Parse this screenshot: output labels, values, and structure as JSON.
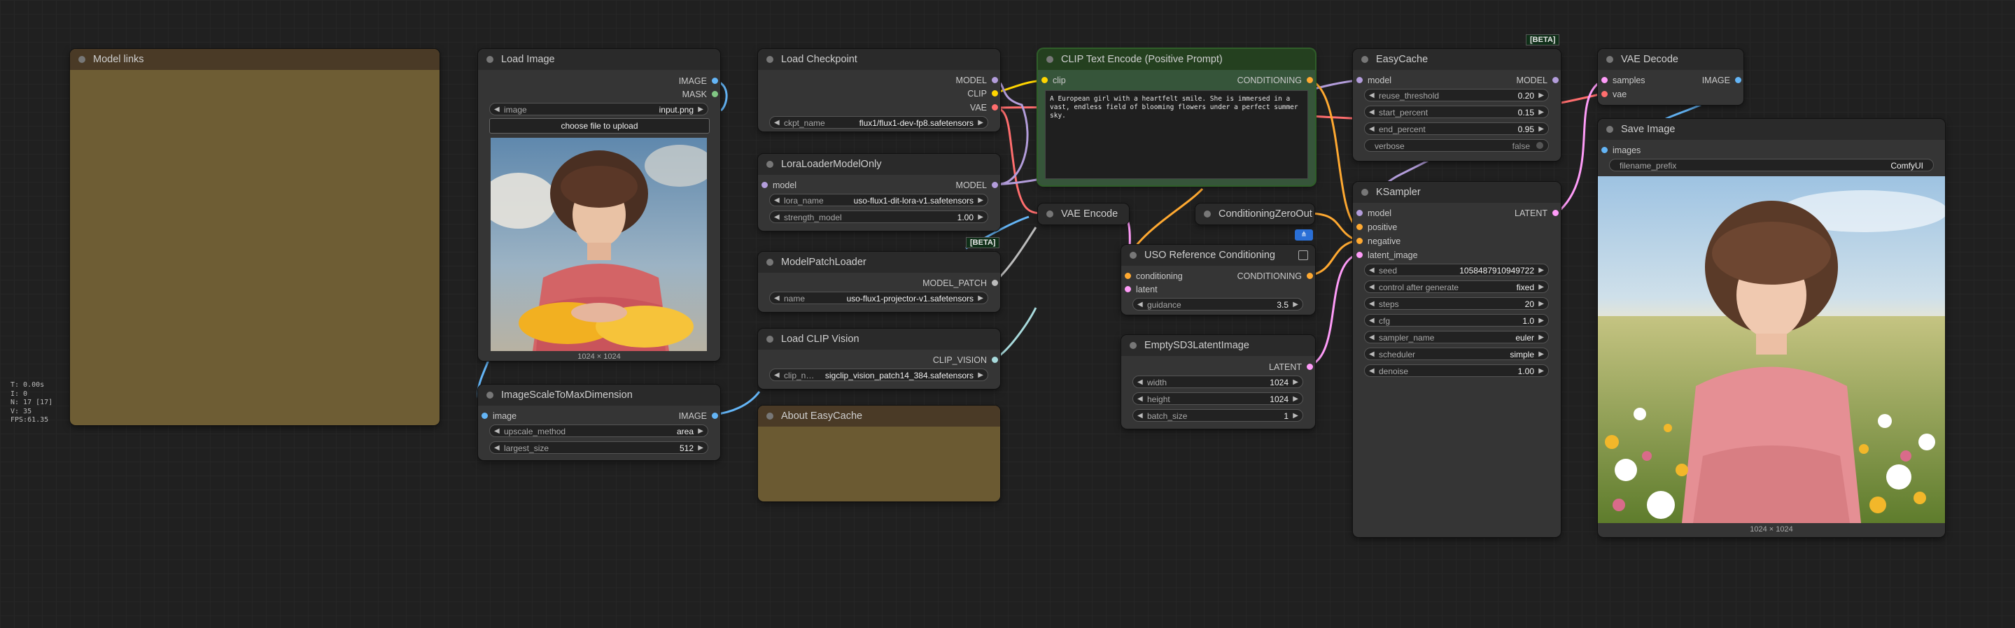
{
  "colors": {
    "model": "#b39ddb",
    "clip": "#ffd500",
    "vae": "#ff6e6e",
    "conditioning": "#ffa931",
    "latent": "#ff9cf9",
    "image": "#64b5f6",
    "mask": "#81c784",
    "model_patch": "#bbbbbb",
    "clip_vision": "#a8dadc"
  },
  "stats": {
    "t": "T: 0.00s",
    "i": "I: 0",
    "n": "N: 17 [17]",
    "v": "V: 35",
    "fps": "FPS:61.35"
  },
  "model_links": {
    "title": "Model links"
  },
  "load_image": {
    "title": "Load Image",
    "out_image": "IMAGE",
    "out_mask": "MASK",
    "image_label": "image",
    "image_value": "input.png",
    "upload_button": "choose file to upload",
    "size": "1024 × 1024"
  },
  "image_scale": {
    "title": "ImageScaleToMaxDimension",
    "in_image": "image",
    "out_image": "IMAGE",
    "upscale_label": "upscale_method",
    "upscale_value": "area",
    "largest_label": "largest_size",
    "largest_value": "512"
  },
  "load_checkpoint": {
    "title": "Load Checkpoint",
    "out_model": "MODEL",
    "out_clip": "CLIP",
    "out_vae": "VAE",
    "ckpt_label": "ckpt_name",
    "ckpt_value": "flux1/flux1-dev-fp8.safetensors"
  },
  "lora_loader": {
    "title": "LoraLoaderModelOnly",
    "in_model": "model",
    "out_model": "MODEL",
    "lora_label": "lora_name",
    "lora_value": "uso-flux1-dit-lora-v1.safetensors",
    "strength_label": "strength_model",
    "strength_value": "1.00"
  },
  "model_patch_loader": {
    "title": "ModelPatchLoader",
    "badge": "[BETA]",
    "out_patch": "MODEL_PATCH",
    "name_label": "name",
    "name_value": "uso-flux1-projector-v1.safetensors"
  },
  "load_clip_vision": {
    "title": "Load CLIP Vision",
    "out_clip_vision": "CLIP_VISION",
    "clip_label": "clip_n…",
    "clip_value": "sigclip_vision_patch14_384.safetensors"
  },
  "about_easycache": {
    "title": "About EasyCache"
  },
  "clip_text_encode": {
    "title": "CLIP Text Encode (Positive Prompt)",
    "in_clip": "clip",
    "out_cond": "CONDITIONING",
    "prompt": "A European girl with a heartfelt smile. She is immersed in a vast, endless field of blooming flowers under a perfect summer sky."
  },
  "vae_encode": {
    "title": "VAE Encode"
  },
  "cond_zero_out": {
    "title": "ConditioningZeroOut"
  },
  "uso_ref": {
    "title": "USO Reference Conditioning",
    "in_cond": "conditioning",
    "in_latent": "latent",
    "out_cond": "CONDITIONING",
    "guidance_label": "guidance",
    "guidance_value": "3.5"
  },
  "empty_latent": {
    "title": "EmptySD3LatentImage",
    "out_latent": "LATENT",
    "width_label": "width",
    "width_value": "1024",
    "height_label": "height",
    "height_value": "1024",
    "batch_label": "batch_size",
    "batch_value": "1"
  },
  "easycache": {
    "title": "EasyCache",
    "badge": "[BETA]",
    "in_model": "model",
    "out_model": "MODEL",
    "reuse_label": "reuse_threshold",
    "reuse_value": "0.20",
    "start_label": "start_percent",
    "start_value": "0.15",
    "end_label": "end_percent",
    "end_value": "0.95",
    "verbose_label": "verbose",
    "verbose_value": "false"
  },
  "ksampler": {
    "title": "KSampler",
    "in_model": "model",
    "in_positive": "positive",
    "in_negative": "negative",
    "in_latent": "latent_image",
    "out_latent": "LATENT",
    "seed_label": "seed",
    "seed_value": "1058487910949722",
    "control_label": "control after generate",
    "control_value": "fixed",
    "steps_label": "steps",
    "steps_value": "20",
    "cfg_label": "cfg",
    "cfg_value": "1.0",
    "sampler_label": "sampler_name",
    "sampler_value": "euler",
    "scheduler_label": "scheduler",
    "scheduler_value": "simple",
    "denoise_label": "denoise",
    "denoise_value": "1.00"
  },
  "vae_decode": {
    "title": "VAE Decode",
    "in_samples": "samples",
    "in_vae": "vae",
    "out_image": "IMAGE"
  },
  "save_image": {
    "title": "Save Image",
    "in_images": "images",
    "prefix_label": "filename_prefix",
    "prefix_value": "ComfyUI",
    "size": "1024 × 1024"
  }
}
